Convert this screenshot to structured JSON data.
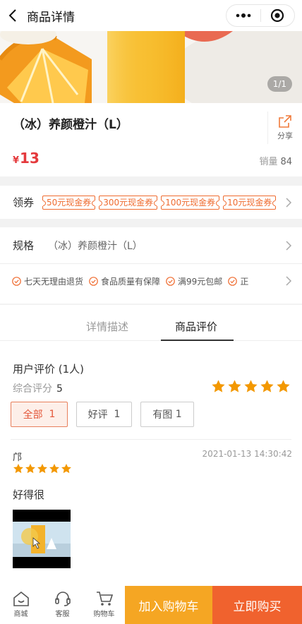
{
  "header": {
    "title": "商品详情",
    "back_icon": "chevron-left-icon",
    "more_icon": "more-dots-icon",
    "target_icon": "target-icon"
  },
  "banner": {
    "page_indicator": "1/1"
  },
  "product": {
    "name": "（冰）养颜橙汁（L）",
    "share_label": "分享",
    "currency": "¥",
    "price": "13",
    "sales_label": "销量",
    "sales_count": "84"
  },
  "coupon": {
    "label": "领券",
    "items": [
      "50元现金券",
      "300元现金券",
      "100元现金券",
      "10元现金券"
    ]
  },
  "spec": {
    "label": "规格",
    "value": "（冰）养颜橙汁（L）"
  },
  "guarantees": [
    "七天无理由退货",
    "食品质量有保障",
    "满99元包邮",
    "正"
  ],
  "tabs": {
    "detail": "详情描述",
    "reviews": "商品评价"
  },
  "reviews": {
    "title": "用户评价 (1人)",
    "score_label": "综合评分",
    "score": "5",
    "rating_stars": 5,
    "filters": [
      {
        "label": "全部",
        "count": "1"
      },
      {
        "label": "好评",
        "count": "1"
      },
      {
        "label": "有图",
        "count": "1"
      }
    ],
    "items": [
      {
        "user": "邝",
        "time": "2021-01-13 14:30:42",
        "stars": 5,
        "text": "好得很"
      }
    ]
  },
  "bottombar": {
    "home": "商城",
    "service": "客服",
    "cart": "购物车",
    "add_to_cart": "加入购物车",
    "buy_now": "立即购买"
  },
  "colors": {
    "price": "#e4393c",
    "coupon": "#ef6b2f",
    "star": "#f39800",
    "cart_button": "#f5a623",
    "buy_button": "#f0622e"
  }
}
